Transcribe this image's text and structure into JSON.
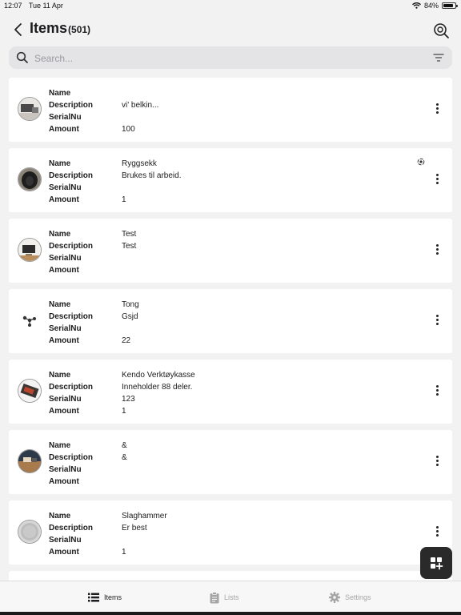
{
  "status": {
    "time": "12:07",
    "date": "Tue 11 Apr",
    "battery": "84%",
    "battery_level": 0.84
  },
  "header": {
    "title": "Items",
    "count": "(501)"
  },
  "search": {
    "placeholder": "Search..."
  },
  "field_labels": {
    "name": "Name",
    "description": "Description",
    "serial": "SerialNu",
    "amount": "Amount"
  },
  "items": [
    {
      "name": "",
      "description": "vi' belkin...",
      "serial": "",
      "amount": "100"
    },
    {
      "name": "Ryggsekk",
      "description": "Brukes til arbeid.",
      "serial": "",
      "amount": "1"
    },
    {
      "name": "Test",
      "description": "Test",
      "serial": "",
      "amount": ""
    },
    {
      "name": "Tong",
      "description": "Gsjd",
      "serial": "",
      "amount": "22"
    },
    {
      "name": "Kendo Verktøykasse",
      "description": "Inneholder 88 deler.",
      "serial": "123",
      "amount": "1"
    },
    {
      "name": "&",
      "description": "&",
      "serial": "",
      "amount": ""
    },
    {
      "name": "Slaghammer",
      "description": "Er best",
      "serial": "",
      "amount": "1"
    }
  ],
  "tabs": {
    "items": "Items",
    "lists": "Lists",
    "settings": "Settings"
  },
  "icons": {
    "back": "chevron-left-icon",
    "scan": "scan-search-icon",
    "search": "search-icon",
    "filter": "filter-icon",
    "more": "more-vertical-icon",
    "sync": "sync-icon",
    "fab": "add-grid-icon",
    "items_tab": "list-icon",
    "lists_tab": "clipboard-icon",
    "settings_tab": "gear-icon"
  },
  "colors": {
    "background": "#f2f2f2",
    "card": "#ffffff",
    "fab": "#2a2a2a",
    "tab_active": "#1c1c1e",
    "tab_inactive": "#a6a6a6"
  }
}
